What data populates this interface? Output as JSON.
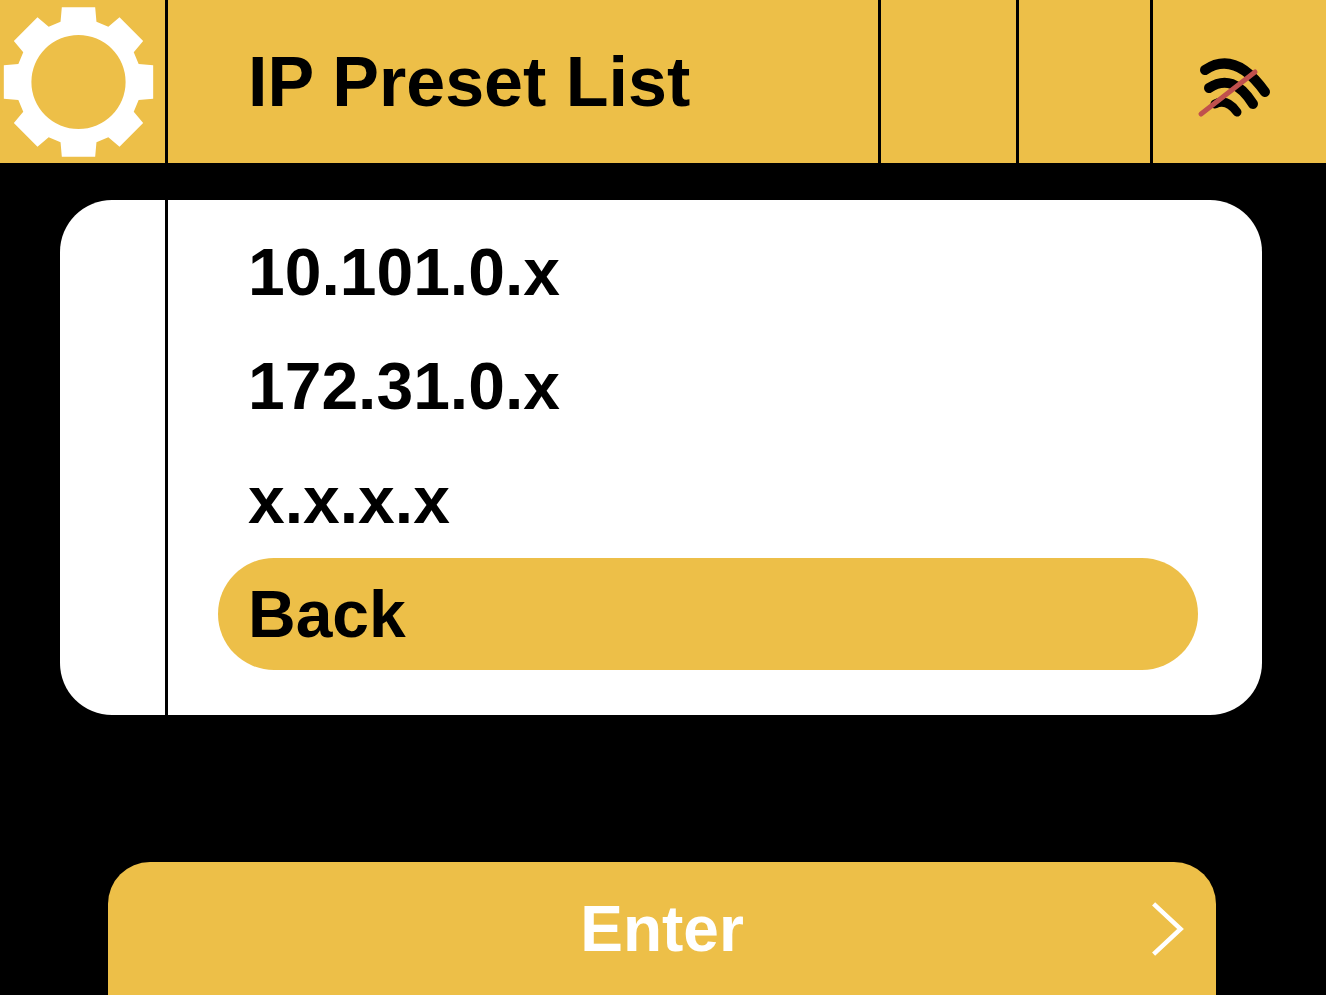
{
  "header": {
    "title": "IP Preset List"
  },
  "presets": [
    {
      "label": "10.101.0.x",
      "selected": false
    },
    {
      "label": "172.31.0.x",
      "selected": false
    },
    {
      "label": "x.x.x.x",
      "selected": false
    },
    {
      "label": "Back",
      "selected": true
    }
  ],
  "enter_button": {
    "label": "Enter"
  }
}
